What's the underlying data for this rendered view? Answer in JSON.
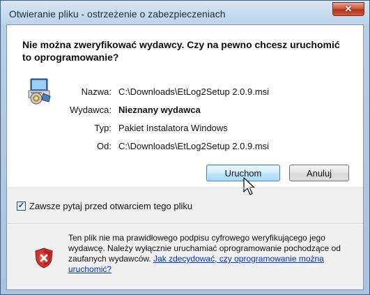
{
  "window": {
    "title": "Otwieranie pliku - ostrzeżenie o zabezpieczeniach",
    "close_glyph": "✕"
  },
  "dialog": {
    "headline": "Nie można zweryfikować wydawcy. Czy na pewno chcesz uruchomić to oprogramowanie?",
    "file_icon": "installer-package-icon",
    "fields": {
      "name_label": "Nazwa:",
      "name_value": "C:\\Downloads\\EtLog2Setup 2.0.9.msi",
      "publisher_label": "Wydawca:",
      "publisher_value": "Nieznany wydawca",
      "type_label": "Typ:",
      "type_value": "Pakiet Instalatora Windows",
      "from_label": "Od:",
      "from_value": "C:\\Downloads\\EtLog2Setup 2.0.9.msi"
    },
    "buttons": {
      "run_label": "Uruchom",
      "cancel_label": "Anuluj"
    },
    "always_ask": {
      "label": "Zawsze pytaj przed otwarciem tego pliku",
      "checked": true,
      "check_glyph": "✓"
    },
    "warning": {
      "icon": "security-shield-error-icon",
      "text": "Ten plik nie ma prawidłowego podpisu cyfrowego weryfikującego jego wydawcę. Należy wyłącznie uruchamiać oprogramowanie pochodzące od zaufanych wydawców. ",
      "link": "Jak zdecydować, czy oprogramowanie można uruchomić?"
    }
  },
  "colors": {
    "link": "#0033cc",
    "close_button": "#c8452b",
    "default_button_border": "#3c7fb1"
  }
}
